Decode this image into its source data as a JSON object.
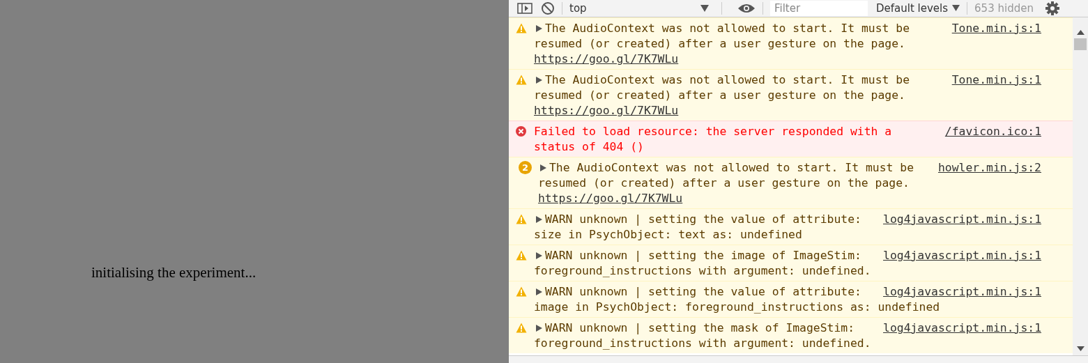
{
  "page": {
    "status_text": "initialising the experiment..."
  },
  "devtools": {
    "toolbar": {
      "context": "top",
      "filter_placeholder": "Filter",
      "levels": "Default levels",
      "hidden_count": "653 hidden"
    },
    "messages": [
      {
        "kind": "warning",
        "expandable": true,
        "lines": [
          "The AudioContext was not allowed to start. It must be",
          "resumed (or created) after a user gesture on the page."
        ],
        "link": "https://goo.gl/7K7WLu",
        "source": "Tone.min.js:1"
      },
      {
        "kind": "warning",
        "expandable": true,
        "lines": [
          "The AudioContext was not allowed to start. It must be",
          "resumed (or created) after a user gesture on the page."
        ],
        "link": "https://goo.gl/7K7WLu",
        "source": "Tone.min.js:1"
      },
      {
        "kind": "error",
        "expandable": false,
        "lines": [
          "Failed to load resource: the server responded with a",
          "status of 404 ()"
        ],
        "source": "/favicon.ico:1"
      },
      {
        "kind": "warning",
        "expandable": true,
        "count": "2",
        "lines": [
          "The AudioContext was not allowed to start. It must be",
          "resumed (or created) after a user gesture on the page."
        ],
        "link": "https://goo.gl/7K7WLu",
        "source": "howler.min.js:2"
      },
      {
        "kind": "warning",
        "expandable": true,
        "lines": [
          "WARN unknown | setting the value of attribute:",
          "size in PsychObject: text as: undefined"
        ],
        "source": "log4javascript.min.js:1"
      },
      {
        "kind": "warning",
        "expandable": true,
        "lines": [
          "WARN unknown | setting the image of ImageStim:",
          "foreground_instructions with argument: undefined."
        ],
        "source": "log4javascript.min.js:1"
      },
      {
        "kind": "warning",
        "expandable": true,
        "lines": [
          "WARN unknown | setting the value of attribute:",
          "image in PsychObject: foreground_instructions as: undefined"
        ],
        "source": "log4javascript.min.js:1"
      },
      {
        "kind": "warning",
        "expandable": true,
        "lines": [
          "WARN unknown | setting the mask of ImageStim:",
          "foreground_instructions with argument: undefined."
        ],
        "source": "log4javascript.min.js:1"
      }
    ]
  }
}
